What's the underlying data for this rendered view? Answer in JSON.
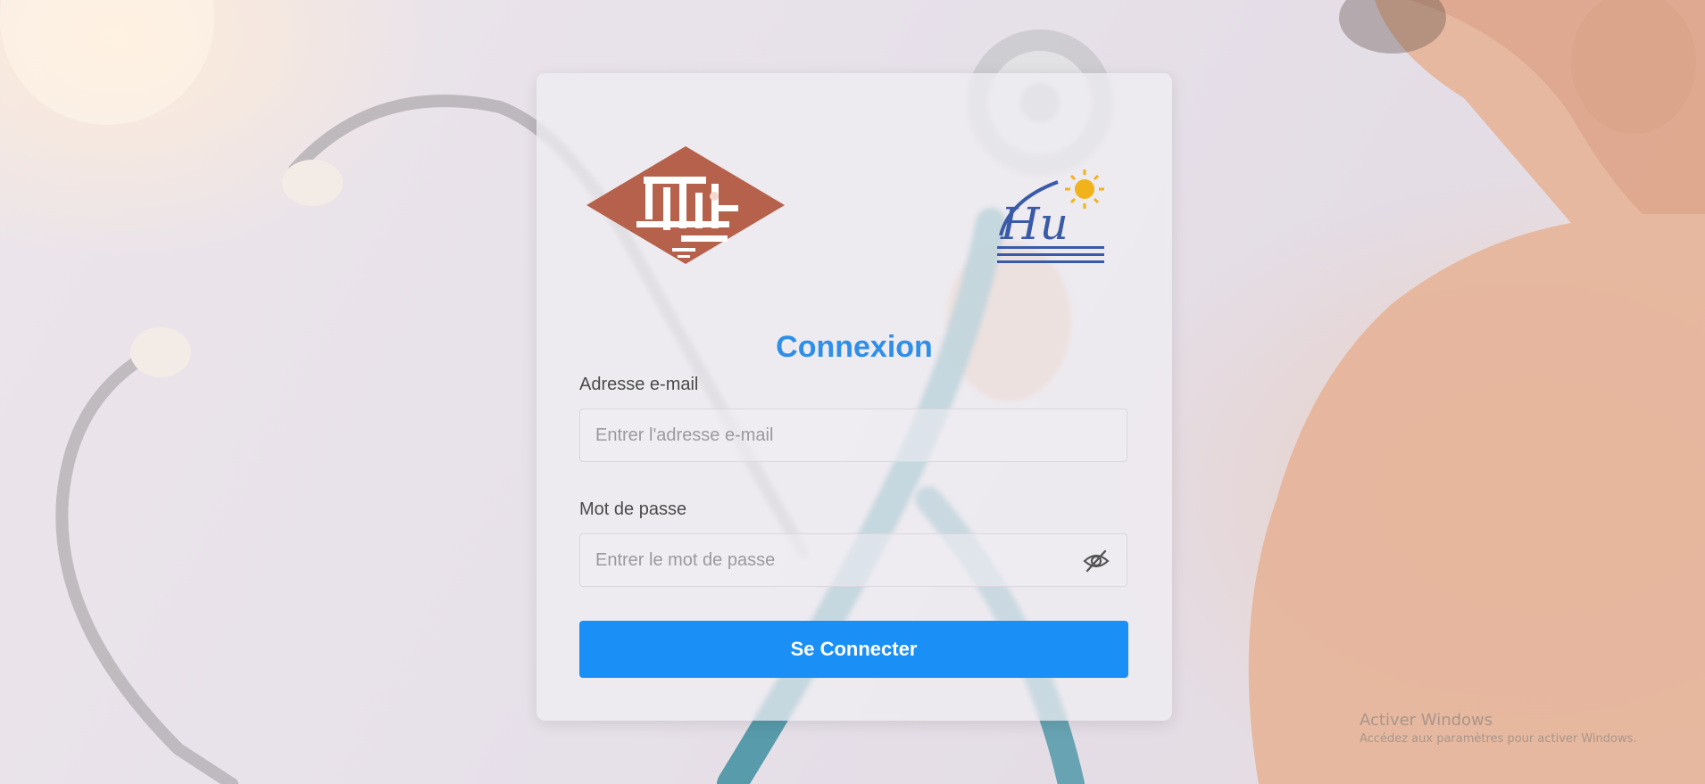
{
  "login": {
    "title": "Connexion",
    "email": {
      "label": "Adresse e-mail",
      "placeholder": "Entrer l'adresse e-mail",
      "value": ""
    },
    "password": {
      "label": "Mot de passe",
      "placeholder": "Entrer le mot de passe",
      "value": "",
      "toggle_icon": "eye-slash-icon"
    },
    "submit_label": "Se Connecter"
  },
  "logos": {
    "left": "university-logo",
    "right": "chu-hospital-logo"
  },
  "watermark": {
    "title": "Activer Windows",
    "subtitle": "Accédez aux paramètres pour activer Windows."
  },
  "colors": {
    "accent": "#1a8ff5",
    "title": "#2f8fe8",
    "university_logo": "#b5614b",
    "chu_blue": "#3a5aa8",
    "chu_sun": "#f2b21b"
  }
}
